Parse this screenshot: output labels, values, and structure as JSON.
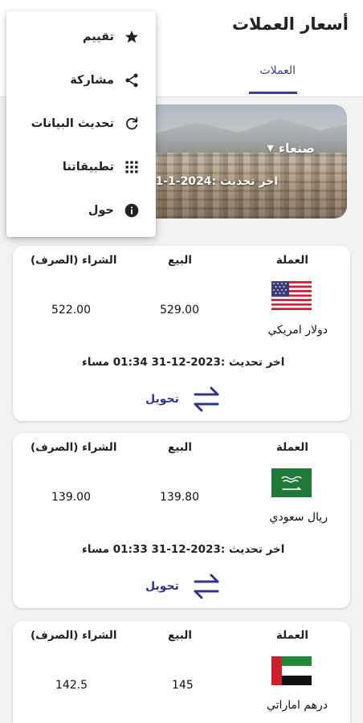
{
  "header": {
    "title": "أسعار العملات",
    "tab_label": "العملات"
  },
  "banner": {
    "city": "صنعاء",
    "updated": "اخر تحديث :2024-1-1"
  },
  "columns": {
    "currency": "العملة",
    "sell": "البيع",
    "buy": "الشراء (الصرف)"
  },
  "cards": [
    {
      "name": "دولار امريكي",
      "flag": "us-flag-icon",
      "sell": "529.00",
      "buy": "522.00",
      "updated": "اخر تحديث :2023-12-31 01:34 مساء",
      "convert_label": "تحويل"
    },
    {
      "name": "ريال سعودي",
      "flag": "sa-flag-icon",
      "sell": "139.80",
      "buy": "139.00",
      "updated": "اخر تحديث :2023-12-31 01:33 مساء",
      "convert_label": "تحويل"
    },
    {
      "name": "درهم اماراتي",
      "flag": "ae-flag-icon",
      "sell": "145",
      "buy": "142.5"
    }
  ],
  "menu": {
    "items": [
      {
        "label": "تقييم",
        "icon": "star-icon"
      },
      {
        "label": "مشاركة",
        "icon": "share-icon"
      },
      {
        "label": "تحديث البيانات",
        "icon": "refresh-icon"
      },
      {
        "label": "تطبيقاتنا",
        "icon": "apps-grid-icon"
      },
      {
        "label": "حول",
        "icon": "info-icon"
      }
    ]
  },
  "colors": {
    "accent": "#3a3f9a",
    "background": "#f2f2f2",
    "card": "#ffffff"
  }
}
